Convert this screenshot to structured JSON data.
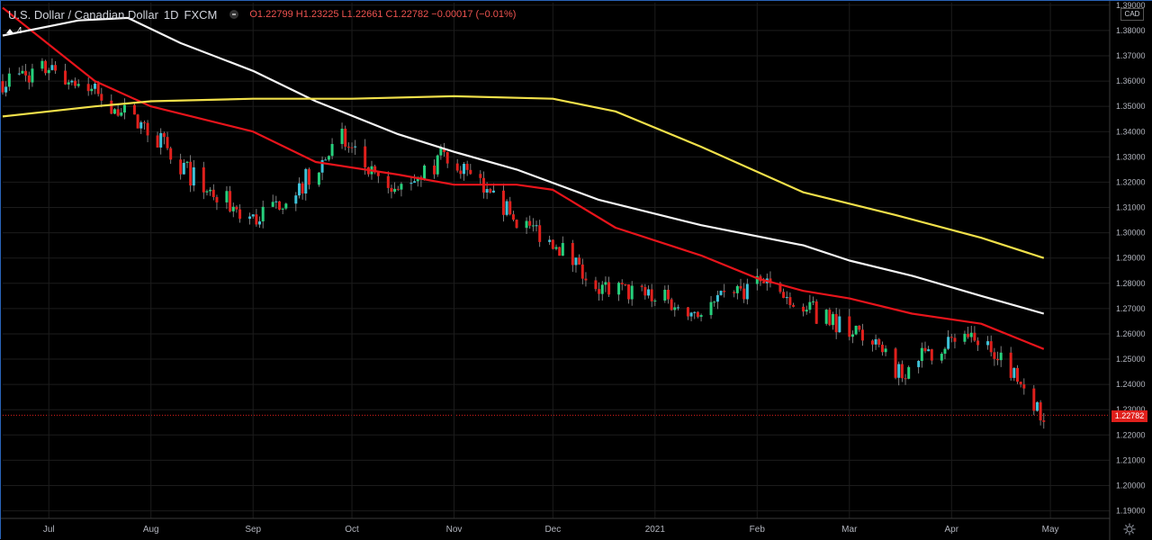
{
  "header": {
    "symbol_title": "U.S. Dollar / Canadian Dollar",
    "interval": "1D",
    "source": "FXCM",
    "open": "O1.22799",
    "high": "H1.23225",
    "low": "L1.22661",
    "close": "C1.22782",
    "change": "−0.00017 (−0.01%)"
  },
  "indicator_count": "4",
  "currency_label": "CAD",
  "last_price_label": "1.22782",
  "colors": {
    "background": "#000000",
    "grid": "#1c1c1c",
    "up": "#26d07c",
    "up_alt": "#3dc3d9",
    "down": "#e0201c",
    "ma_red": "#e8141b",
    "ma_white": "#f5f5f5",
    "ma_yellow": "#f1e04a",
    "last_price": "#e0201c"
  },
  "chart_data": {
    "type": "line",
    "title": "U.S. Dollar / Canadian Dollar",
    "y_range": [
      1.187,
      1.391
    ],
    "x_range": [
      "2020-06-17",
      "2021-05-19"
    ],
    "price_axis_ticks": [
      "1.39000",
      "1.38000",
      "1.37000",
      "1.36000",
      "1.35000",
      "1.34000",
      "1.33000",
      "1.32000",
      "1.31000",
      "1.30000",
      "1.29000",
      "1.28000",
      "1.27000",
      "1.26000",
      "1.25000",
      "1.24000",
      "1.23000",
      "1.22000",
      "1.21000",
      "1.20000",
      "1.19000"
    ],
    "time_axis_labels": [
      "Jul",
      "Aug",
      "Sep",
      "Oct",
      "Nov",
      "Dec",
      "2021",
      "Feb",
      "Mar",
      "Apr",
      "May"
    ],
    "last_price": 1.22782,
    "grid": true,
    "series": [
      {
        "kind": "candles",
        "approx_closes": [
          {
            "date": "2020-06-17",
            "close": 1.36
          },
          {
            "date": "2020-07-01",
            "close": 1.365
          },
          {
            "date": "2020-07-15",
            "close": 1.355
          },
          {
            "date": "2020-08-01",
            "close": 1.34
          },
          {
            "date": "2020-08-15",
            "close": 1.32
          },
          {
            "date": "2020-09-01",
            "close": 1.305
          },
          {
            "date": "2020-09-15",
            "close": 1.318
          },
          {
            "date": "2020-09-28",
            "close": 1.337
          },
          {
            "date": "2020-10-12",
            "close": 1.315
          },
          {
            "date": "2020-10-30",
            "close": 1.331
          },
          {
            "date": "2020-11-15",
            "close": 1.31
          },
          {
            "date": "2020-12-01",
            "close": 1.297
          },
          {
            "date": "2020-12-15",
            "close": 1.278
          },
          {
            "date": "2021-01-01",
            "close": 1.275
          },
          {
            "date": "2021-01-15",
            "close": 1.268
          },
          {
            "date": "2021-02-01",
            "close": 1.281
          },
          {
            "date": "2021-02-15",
            "close": 1.27
          },
          {
            "date": "2021-03-01",
            "close": 1.263
          },
          {
            "date": "2021-03-16",
            "close": 1.245
          },
          {
            "date": "2021-04-01",
            "close": 1.258
          },
          {
            "date": "2021-04-15",
            "close": 1.254
          },
          {
            "date": "2021-04-29",
            "close": 1.228
          }
        ]
      },
      {
        "kind": "moving_average",
        "color": "#e8141b",
        "points": [
          {
            "date": "2020-06-17",
            "value": 1.389
          },
          {
            "date": "2020-07-15",
            "value": 1.36
          },
          {
            "date": "2020-08-01",
            "value": 1.35
          },
          {
            "date": "2020-09-01",
            "value": 1.34
          },
          {
            "date": "2020-09-20",
            "value": 1.328
          },
          {
            "date": "2020-10-15",
            "value": 1.323
          },
          {
            "date": "2020-11-01",
            "value": 1.319
          },
          {
            "date": "2020-11-20",
            "value": 1.319
          },
          {
            "date": "2020-12-01",
            "value": 1.317
          },
          {
            "date": "2020-12-20",
            "value": 1.302
          },
          {
            "date": "2021-01-15",
            "value": 1.291
          },
          {
            "date": "2021-02-01",
            "value": 1.282
          },
          {
            "date": "2021-02-15",
            "value": 1.277
          },
          {
            "date": "2021-03-01",
            "value": 1.274
          },
          {
            "date": "2021-03-20",
            "value": 1.268
          },
          {
            "date": "2021-04-10",
            "value": 1.264
          },
          {
            "date": "2021-04-29",
            "value": 1.254
          }
        ]
      },
      {
        "kind": "moving_average",
        "color": "#f5f5f5",
        "points": [
          {
            "date": "2020-06-17",
            "value": 1.378
          },
          {
            "date": "2020-07-10",
            "value": 1.384
          },
          {
            "date": "2020-07-25",
            "value": 1.385
          },
          {
            "date": "2020-08-10",
            "value": 1.375
          },
          {
            "date": "2020-09-01",
            "value": 1.364
          },
          {
            "date": "2020-09-20",
            "value": 1.352
          },
          {
            "date": "2020-10-15",
            "value": 1.339
          },
          {
            "date": "2020-11-01",
            "value": 1.332
          },
          {
            "date": "2020-11-20",
            "value": 1.325
          },
          {
            "date": "2020-12-15",
            "value": 1.313
          },
          {
            "date": "2021-01-15",
            "value": 1.303
          },
          {
            "date": "2021-02-15",
            "value": 1.295
          },
          {
            "date": "2021-03-01",
            "value": 1.289
          },
          {
            "date": "2021-03-20",
            "value": 1.283
          },
          {
            "date": "2021-04-10",
            "value": 1.275
          },
          {
            "date": "2021-04-29",
            "value": 1.268
          }
        ]
      },
      {
        "kind": "moving_average",
        "color": "#f1e04a",
        "points": [
          {
            "date": "2020-06-17",
            "value": 1.346
          },
          {
            "date": "2020-07-15",
            "value": 1.35
          },
          {
            "date": "2020-08-01",
            "value": 1.352
          },
          {
            "date": "2020-09-01",
            "value": 1.353
          },
          {
            "date": "2020-10-01",
            "value": 1.353
          },
          {
            "date": "2020-11-01",
            "value": 1.354
          },
          {
            "date": "2020-12-01",
            "value": 1.353
          },
          {
            "date": "2020-12-20",
            "value": 1.348
          },
          {
            "date": "2021-01-15",
            "value": 1.334
          },
          {
            "date": "2021-02-15",
            "value": 1.316
          },
          {
            "date": "2021-03-15",
            "value": 1.307
          },
          {
            "date": "2021-04-10",
            "value": 1.298
          },
          {
            "date": "2021-04-29",
            "value": 1.29
          }
        ]
      }
    ]
  }
}
